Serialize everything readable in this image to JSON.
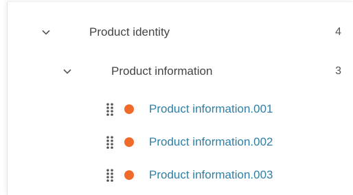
{
  "tree": {
    "group": {
      "label": "Product identity",
      "count": "4",
      "icon": "chevron-down-icon"
    },
    "subgroup": {
      "label": "Product information",
      "count": "3",
      "icon": "chevron-down-icon"
    },
    "items": [
      {
        "label": "Product information.001",
        "status_color": "#f06a2a"
      },
      {
        "label": "Product information.002",
        "status_color": "#f06a2a"
      },
      {
        "label": "Product information.003",
        "status_color": "#f06a2a"
      }
    ]
  },
  "colors": {
    "link": "#2e7fa6",
    "status": "#f06a2a",
    "text": "#444444"
  }
}
